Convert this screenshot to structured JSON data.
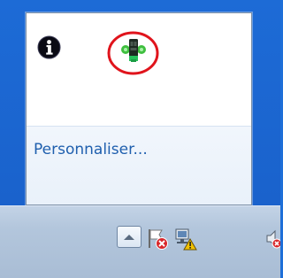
{
  "overflow_popup": {
    "customize_label": "Personnaliser...",
    "icons": [
      "info-icon",
      "tray-app-icon"
    ],
    "highlight_color": "#e0141c"
  },
  "taskbar": {
    "tray_icons": [
      "show-hidden-icons-arrow",
      "action-center-flag-icon",
      "network-icon",
      "volume-icon"
    ]
  },
  "colors": {
    "desktop": "#1e6fd8",
    "link": "#1f5fae",
    "error_badge": "#d8282c",
    "warning_badge": "#f2c200"
  }
}
